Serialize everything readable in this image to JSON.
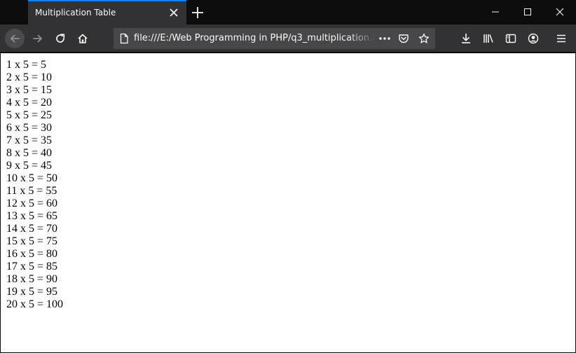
{
  "browser": {
    "tab_title": "Multiplication Table",
    "url": "file:///E:/Web Programming in PHP/q3_multiplication.html",
    "icons": {
      "tab_close": "close-icon",
      "new_tab": "plus-icon",
      "minimize": "minimize-icon",
      "maximize": "maximize-icon",
      "close_window": "close-icon",
      "back": "arrow-left-icon",
      "forward": "arrow-right-icon",
      "reload": "reload-icon",
      "home": "home-icon",
      "page": "page-icon",
      "page_actions": "more-dots-icon",
      "pocket": "pocket-icon",
      "bookmark": "star-icon",
      "downloads": "download-icon",
      "library": "library-icon",
      "sidebar": "sidebar-icon",
      "account": "account-icon",
      "menu": "hamburger-icon"
    },
    "colors": {
      "accent": "#0a84ff",
      "chrome": "#323234",
      "tabstrip": "#0c0c0d",
      "urlbar": "#474749"
    }
  },
  "page": {
    "lines": [
      "1 x 5 = 5",
      "2 x 5 = 10",
      "3 x 5 = 15",
      "4 x 5 = 20",
      "5 x 5 = 25",
      "6 x 5 = 30",
      "7 x 5 = 35",
      "8 x 5 = 40",
      "9 x 5 = 45",
      "10 x 5 = 50",
      "11 x 5 = 55",
      "12 x 5 = 60",
      "13 x 5 = 65",
      "14 x 5 = 70",
      "15 x 5 = 75",
      "16 x 5 = 80",
      "17 x 5 = 85",
      "18 x 5 = 90",
      "19 x 5 = 95",
      "20 x 5 = 100"
    ]
  }
}
